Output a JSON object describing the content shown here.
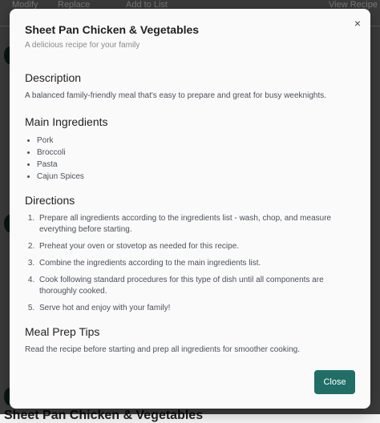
{
  "background": {
    "toolbar": [
      "Modify",
      "Replace",
      "Add to List",
      "View Recipe"
    ],
    "card_title": "Sheet Pan Chicken & Vegetables"
  },
  "modal": {
    "title": "Sheet Pan Chicken & Vegetables",
    "subtitle": "A delicious recipe for your family",
    "close_icon": "×",
    "description_heading": "Description",
    "description": "A balanced family-friendly meal that's easy to prepare and great for busy weeknights.",
    "ingredients_heading": "Main Ingredients",
    "ingredients": [
      "Pork",
      "Broccoli",
      "Pasta",
      "Cajun Spices"
    ],
    "directions_heading": "Directions",
    "directions": [
      "Prepare all ingredients according to the ingredients list - wash, chop, and measure everything before starting.",
      "Preheat your oven or stovetop as needed for this recipe.",
      "Combine the ingredients according to the main ingredients list.",
      "Cook following standard procedures for this type of dish until all components are thoroughly cooked.",
      "Serve hot and enjoy with your family!"
    ],
    "tips_heading": "Meal Prep Tips",
    "tips": "Read the recipe before starting and prep all ingredients for smoother cooking.",
    "close_label": "Close"
  }
}
